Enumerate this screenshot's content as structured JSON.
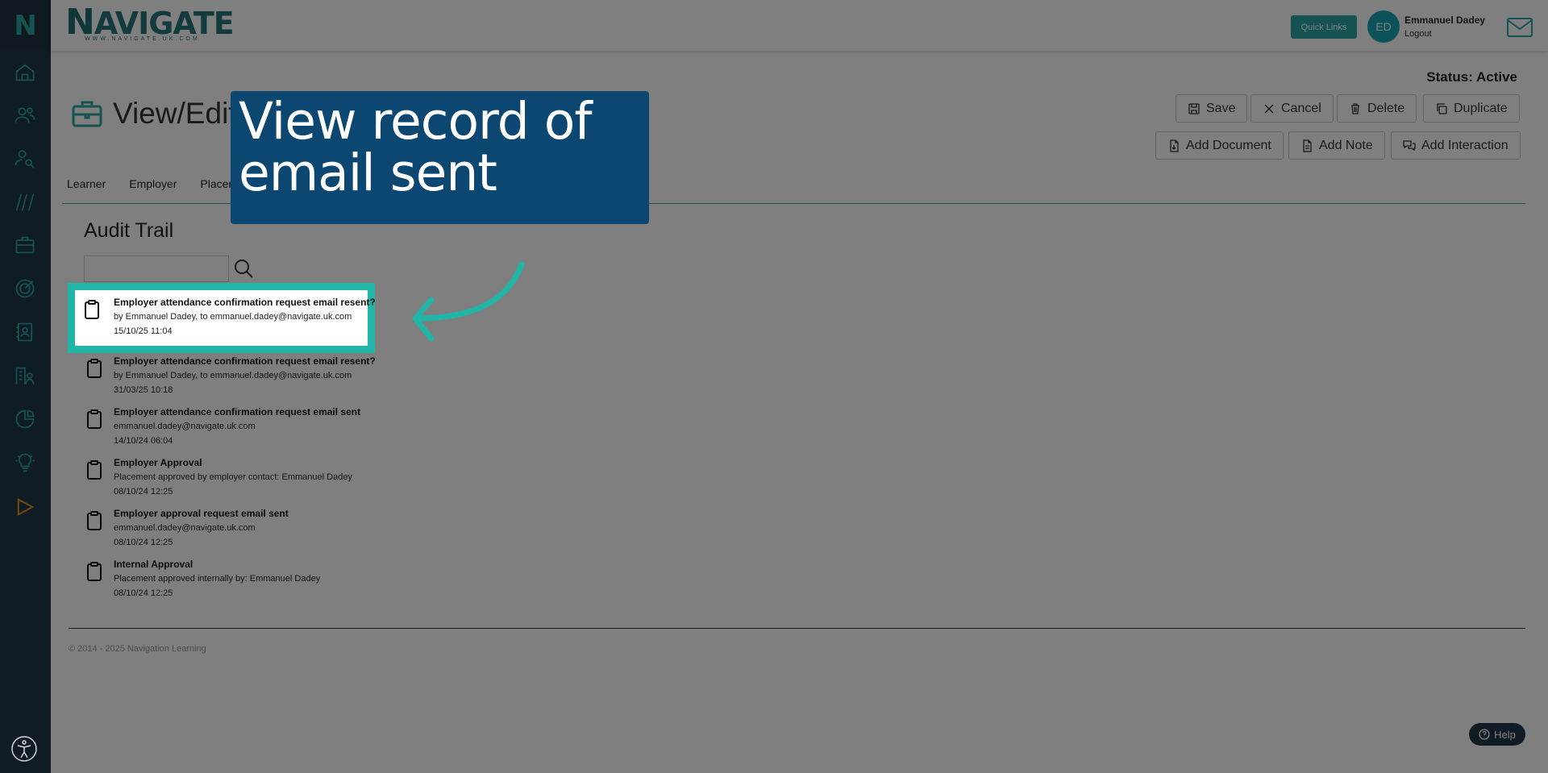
{
  "app": {
    "logo_letter": "N",
    "brand_word": "AVIGATE",
    "brand_first": "N",
    "brand_url": "WWW.NAVIGATE.UK.COM"
  },
  "header": {
    "quick_links_label": "Quick Links",
    "avatar_initials": "ED",
    "user_name": "Emmanuel Dadey",
    "logout_label": "Logout"
  },
  "page": {
    "status": "Status: Active",
    "title": "View/Edit"
  },
  "toolbar": {
    "save_label": "Save",
    "cancel_label": "Cancel",
    "delete_label": "Delete",
    "duplicate_label": "Duplicate",
    "add_document_label": "Add Document",
    "add_note_label": "Add Note",
    "add_interaction_label": "Add Interaction"
  },
  "tabs": [
    {
      "label": "Learner"
    },
    {
      "label": "Employer"
    },
    {
      "label": "Placem"
    }
  ],
  "audit": {
    "title": "Audit Trail",
    "search_placeholder": "",
    "items": [
      {
        "title": "Employer attendance confirmation request email resent?",
        "detail": "by Emmanuel Dadey, to emmanuel.dadey@navigate.uk.com",
        "timestamp": "15/10/25 11:04"
      },
      {
        "title": "Employer attendance confirmation request email resent?",
        "detail": "by Emmanuel Dadey, to emmanuel.dadey@navigate.uk.com",
        "timestamp": "31/03/25 10:18"
      },
      {
        "title": "Employer attendance confirmation request email sent",
        "detail": "emmanuel.dadey@navigate.uk.com",
        "timestamp": "14/10/24 06:04"
      },
      {
        "title": "Employer Approval",
        "detail": "Placement approved by employer contact: Emmanuel Dadey",
        "timestamp": "08/10/24 12:25"
      },
      {
        "title": "Employer approval request email sent",
        "detail": "emmanuel.dadey@navigate.uk.com",
        "timestamp": "08/10/24 12:25"
      },
      {
        "title": "Internal Approval",
        "detail": "Placement approved internally by: Emmanuel Dadey",
        "timestamp": "08/10/24 12:25"
      }
    ]
  },
  "footer": {
    "copyright": "© 2014 - 2025 Navigation Learning",
    "help_label": "Help"
  },
  "callout": {
    "text": "View record of email sent"
  },
  "colors": {
    "sidebar": "#213847",
    "accent": "#2aa7a7",
    "callout_bg": "#0b4770",
    "highlight_border": "#1fb6a7"
  },
  "sidebar_icons": [
    "home-icon",
    "users-icon",
    "user-search-icon",
    "slashes-icon",
    "briefcase-icon",
    "target-icon",
    "contact-card-icon",
    "building-users-icon",
    "pie-chart-icon",
    "lightbulb-icon",
    "play-icon",
    "accessibility-icon"
  ]
}
